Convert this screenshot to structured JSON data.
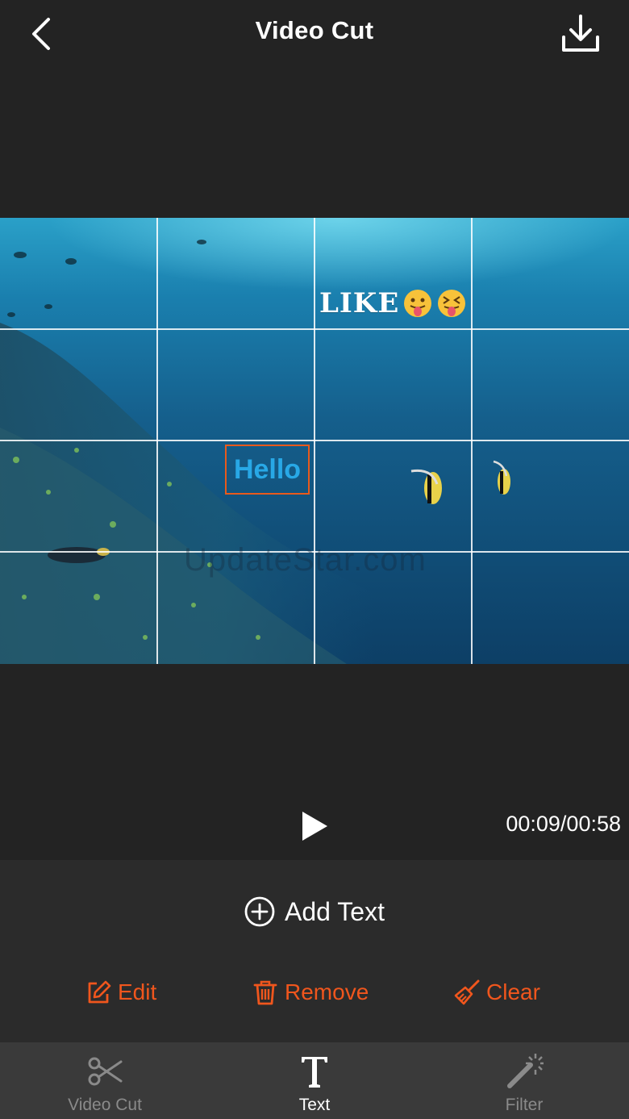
{
  "header": {
    "title": "Video Cut",
    "back_icon": "chevron-left-icon",
    "download_icon": "download-icon"
  },
  "video": {
    "sticker_text": "LIKE",
    "sticker_emojis": [
      "face-with-tongue",
      "squinting-face-with-tongue"
    ],
    "text_overlay": "Hello",
    "watermark": "UpdateStar.com"
  },
  "player": {
    "play_icon": "play-icon",
    "time": "00:09/00:58"
  },
  "panel": {
    "add_text_label": "Add Text",
    "actions": [
      {
        "label": "Edit",
        "icon": "edit-icon"
      },
      {
        "label": "Remove",
        "icon": "trash-icon"
      },
      {
        "label": "Clear",
        "icon": "broom-icon"
      }
    ]
  },
  "tabs": [
    {
      "label": "Video Cut",
      "icon": "scissors-icon",
      "active": false
    },
    {
      "label": "Text",
      "icon": "text-icon",
      "active": true
    },
    {
      "label": "Filter",
      "icon": "magic-wand-icon",
      "active": false
    }
  ],
  "colors": {
    "background": "#232323",
    "panel": "#2b2b2b",
    "tabbar": "#3a3a3a",
    "accent": "#f0561d",
    "text_overlay": "#28a8e6"
  }
}
